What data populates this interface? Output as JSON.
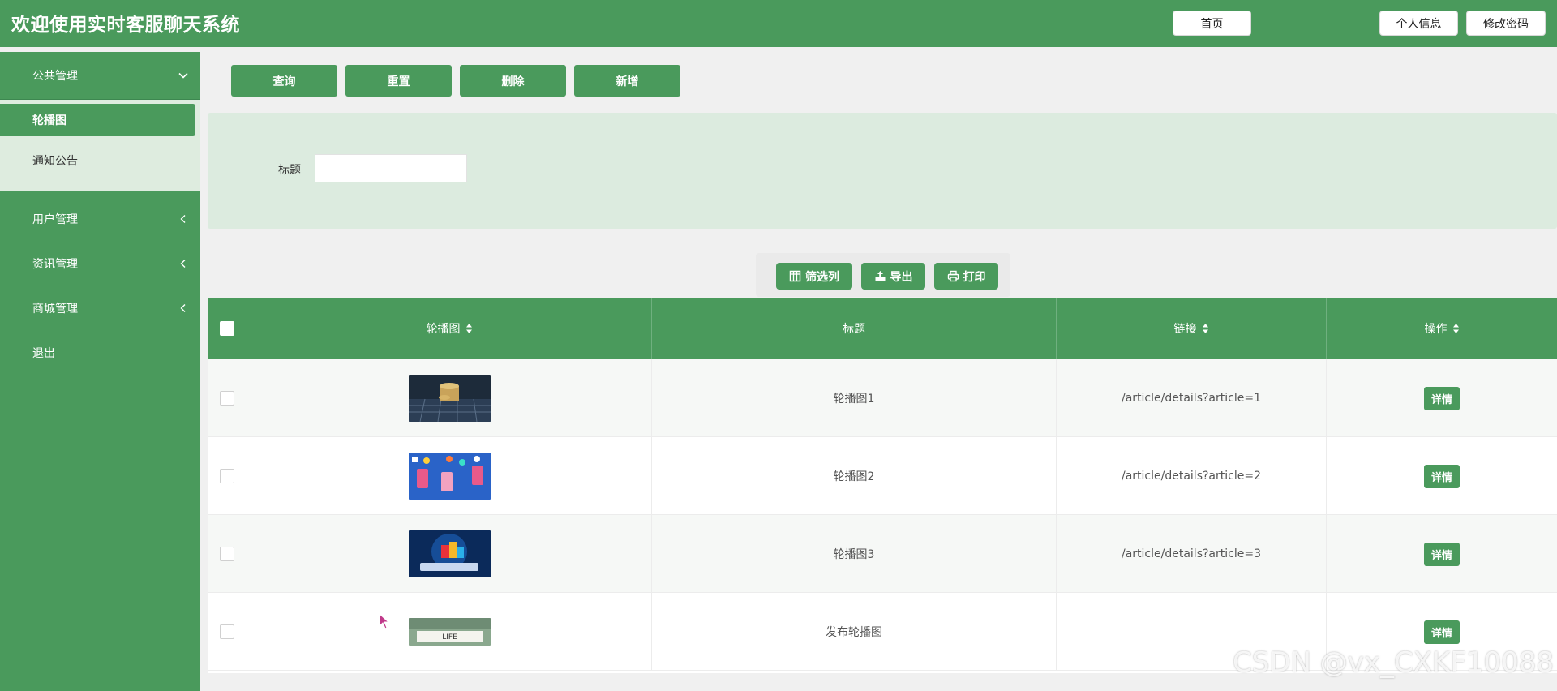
{
  "header": {
    "title": "欢迎使用实时客服聊天系统",
    "home_label": "首页",
    "profile_label": "个人信息",
    "password_label": "修改密码"
  },
  "sidebar": {
    "groups": [
      {
        "label": "公共管理",
        "icon": "chevron-down-icon"
      },
      {
        "label": "用户管理",
        "icon": "chevron-left-icon"
      },
      {
        "label": "资讯管理",
        "icon": "chevron-left-icon"
      },
      {
        "label": "商城管理",
        "icon": "chevron-left-icon"
      },
      {
        "label": "退出"
      }
    ],
    "sub_items": [
      {
        "label": "轮播图",
        "active": true
      },
      {
        "label": "通知公告",
        "active": false
      }
    ]
  },
  "actions": {
    "query": "查询",
    "reset": "重置",
    "delete": "删除",
    "add": "新增"
  },
  "search": {
    "title_label": "标题",
    "title_value": ""
  },
  "toolbar": {
    "filter_columns": "筛选列",
    "export": "导出",
    "print": "打印"
  },
  "table": {
    "columns": [
      "轮播图",
      "标题",
      "链接",
      "操作"
    ],
    "rows": [
      {
        "image": "coins-on-keyboard",
        "title": "轮播图1",
        "link": "/article/details?article=1",
        "action": "详情"
      },
      {
        "image": "social-apps-hands",
        "title": "轮播图2",
        "link": "/article/details?article=2",
        "action": "详情"
      },
      {
        "image": "shopping-bags-tablet",
        "title": "轮播图3",
        "link": "/article/details?article=3",
        "action": "详情"
      },
      {
        "image": "life-banner",
        "title": "发布轮播图",
        "link": "",
        "action": "详情",
        "image_text": "LIFE"
      }
    ]
  },
  "watermark": "CSDN @vx_CXKF10088",
  "colors": {
    "primary": "#4a9a5c",
    "submenu_bg": "#deecdf",
    "search_panel_bg": "#dcebdf"
  }
}
